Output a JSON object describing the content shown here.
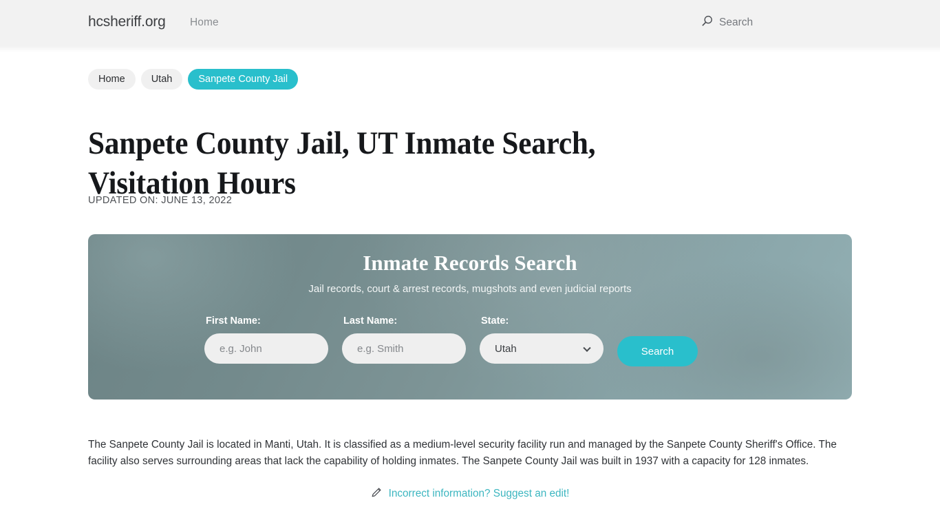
{
  "header": {
    "brand": "hcsheriff.org",
    "nav": [
      {
        "label": "Home"
      }
    ],
    "search": {
      "label": "Search",
      "icon": "search-icon"
    }
  },
  "breadcrumbs": [
    {
      "label": "Home",
      "active": false
    },
    {
      "label": "Utah",
      "active": false
    },
    {
      "label": "Sanpete County Jail",
      "active": true
    }
  ],
  "page": {
    "title": "Sanpete County Jail, UT Inmate Search, Visitation Hours",
    "updated": "UPDATED ON: JUNE 13, 2022"
  },
  "hero": {
    "title": "Inmate Records Search",
    "subtitle": "Jail records, court & arrest records, mugshots and even judicial reports",
    "fields": {
      "first_name": {
        "label": "First Name:",
        "value": "",
        "placeholder": "e.g. John"
      },
      "last_name": {
        "label": "Last Name:",
        "value": "",
        "placeholder": "e.g. Smith"
      },
      "state": {
        "label": "State:",
        "value": "Utah",
        "icon": "chevron-down-icon"
      }
    },
    "search_button": "Search"
  },
  "content": {
    "paragraph": "The Sanpete County Jail is located in Manti, Utah. It is classified as a medium-level security facility run and managed by the Sanpete County Sheriff's Office. The facility also serves surrounding areas that lack the capability of holding inmates. The Sanpete County Jail was built in 1937 with a capacity for 128 inmates.",
    "suggest_link": "Incorrect information? Suggest an edit!",
    "suggest_icon": "pencil-icon"
  },
  "colors": {
    "accent": "#29bfcc",
    "link": "#3cb6c0",
    "header_bg": "#f2f2f2",
    "hero_bg": "#7d9496"
  }
}
